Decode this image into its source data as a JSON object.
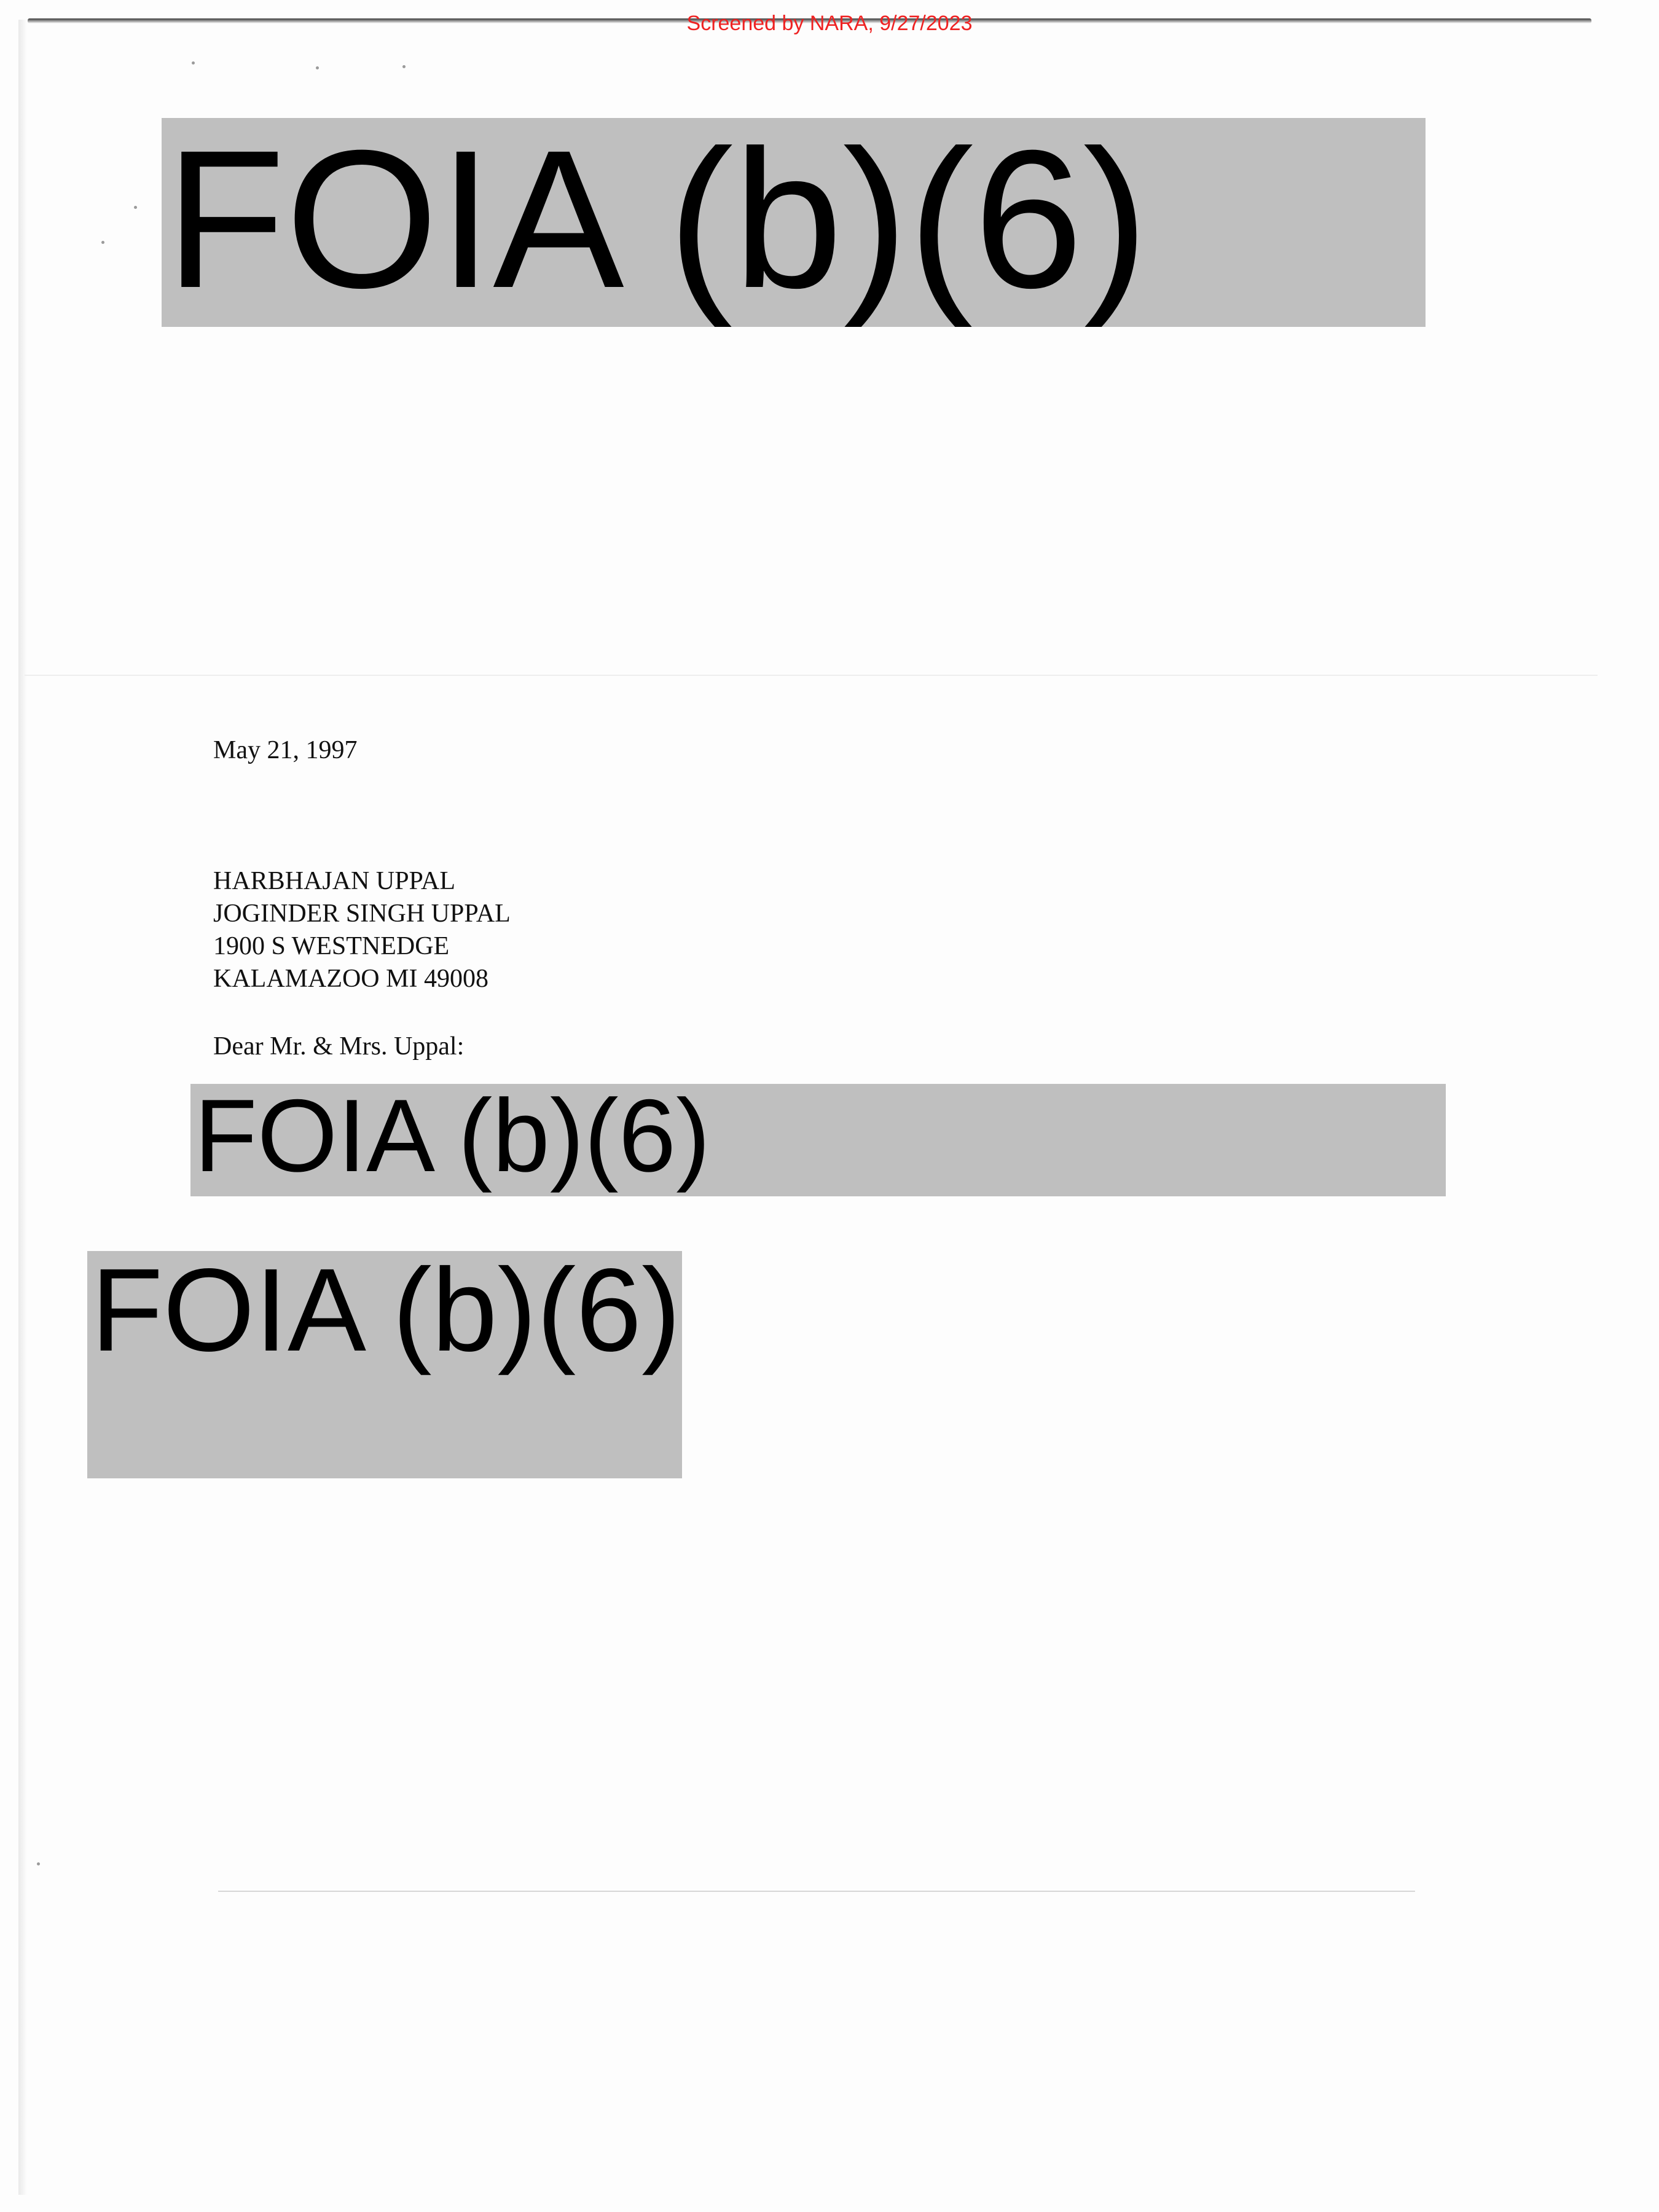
{
  "stamp": {
    "text": "Screened by NARA, 9/27/2023",
    "color": "#ee2222"
  },
  "redactions": [
    {
      "label": "FOIA (b)(6)"
    },
    {
      "label": "FOIA (b)(6)"
    },
    {
      "label": "FOIA (b)(6)"
    }
  ],
  "redaction_color": "#bfbfbf",
  "letter": {
    "date": "May 21, 1997",
    "address_lines": [
      "HARBHAJAN UPPAL",
      "JOGINDER SINGH UPPAL",
      "1900 S WESTNEDGE",
      "KALAMAZOO MI 49008"
    ],
    "salutation": "Dear Mr. & Mrs. Uppal:"
  }
}
